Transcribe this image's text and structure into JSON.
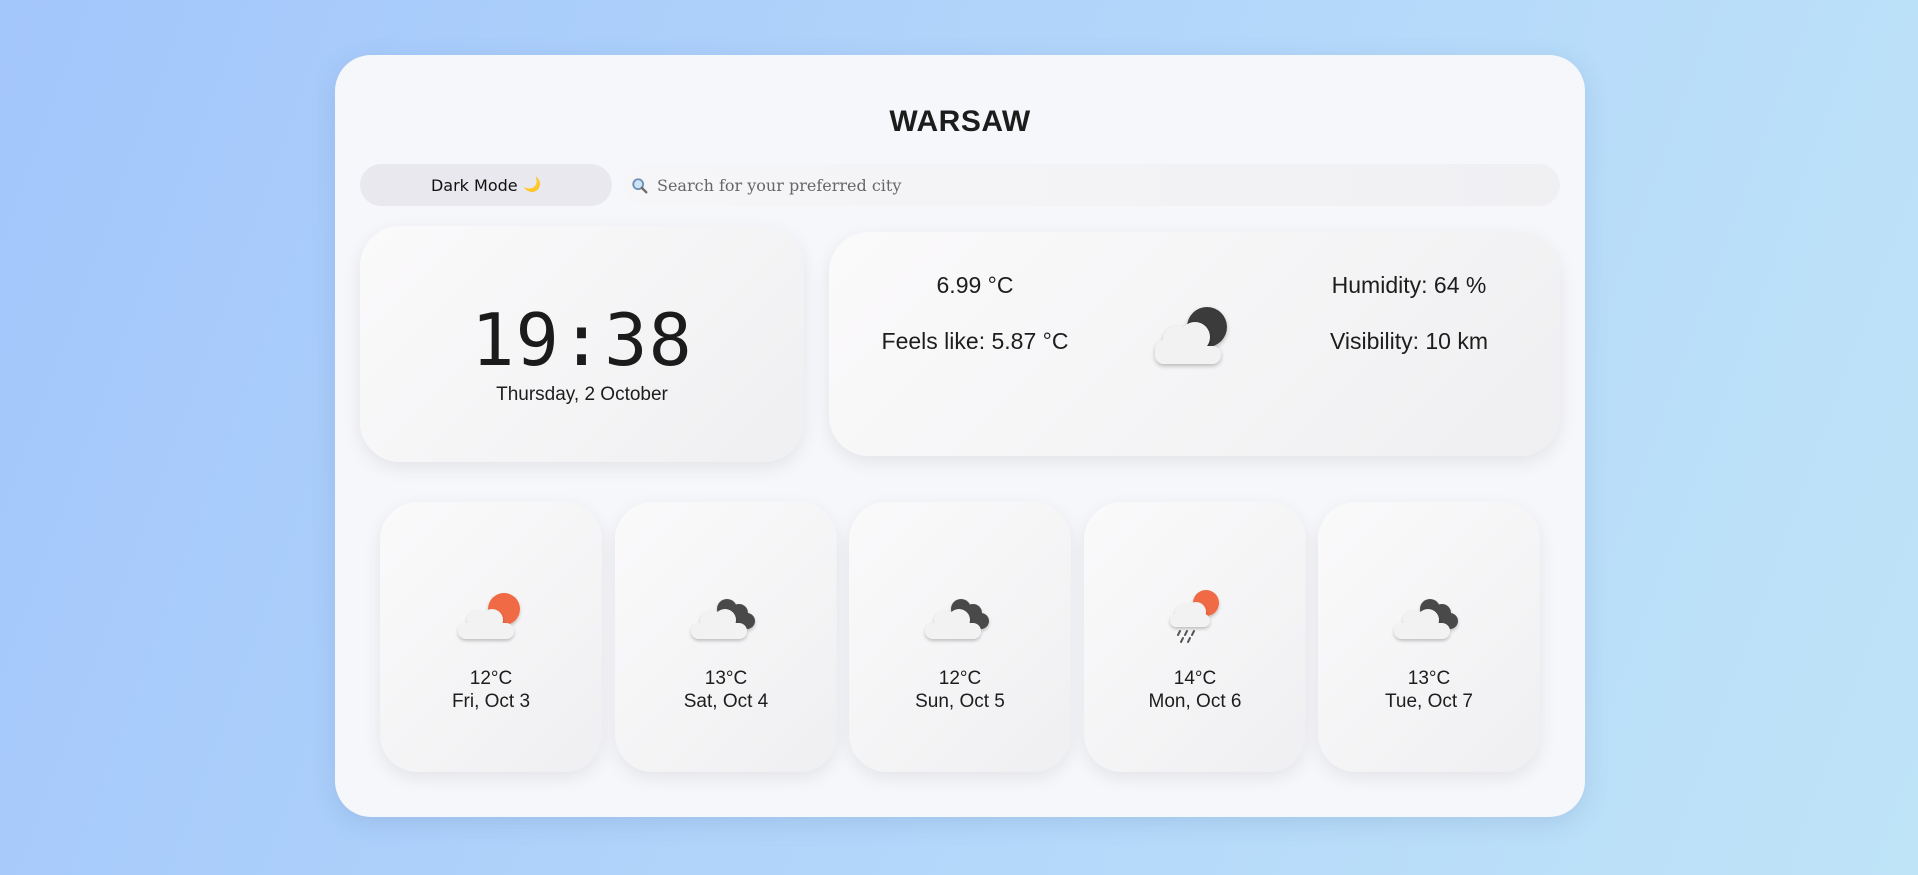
{
  "header": {
    "city": "WARSAW"
  },
  "controls": {
    "mode_label": "Dark Mode",
    "mode_glyph": "🌙",
    "search_placeholder": "Search for your preferred city"
  },
  "clock": {
    "time": "19:38",
    "date": "Thursday, 2 October"
  },
  "current": {
    "temp": "6.99 °C",
    "feels_like": "Feels like: 5.87 °C",
    "humidity": "Humidity: 64 %",
    "visibility": "Visibility: 10 km",
    "icon": "night-cloudy-icon"
  },
  "forecast": [
    {
      "temp": "12°C",
      "date": "Fri, Oct 3",
      "icon": "partly-sunny-icon"
    },
    {
      "temp": "13°C",
      "date": "Sat, Oct 4",
      "icon": "overcast-icon"
    },
    {
      "temp": "12°C",
      "date": "Sun, Oct 5",
      "icon": "overcast-icon"
    },
    {
      "temp": "14°C",
      "date": "Mon, Oct 6",
      "icon": "sun-rain-icon"
    },
    {
      "temp": "13°C",
      "date": "Tue, Oct 7",
      "icon": "overcast-icon"
    }
  ],
  "colors": {
    "sun": "#ef6a45",
    "dark_cloud": "#4a4a4a",
    "light_cloud": "#f2f2f2",
    "moon_dark": "#3a3a3a"
  }
}
